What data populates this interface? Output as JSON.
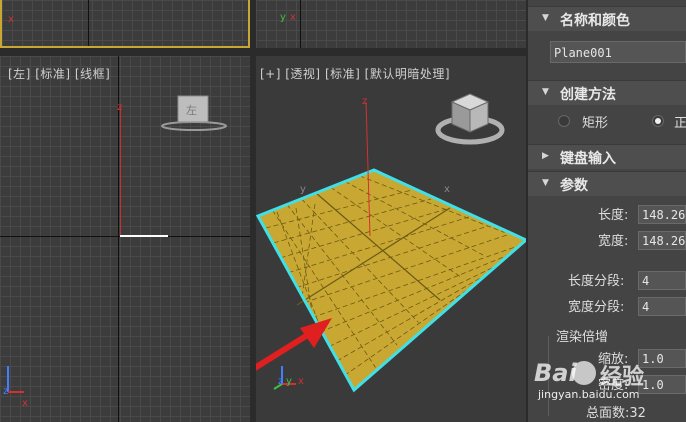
{
  "viewports": {
    "left": {
      "labels": [
        "[左]",
        "[标准]",
        "[线框]"
      ]
    },
    "perspective": {
      "labels": [
        "[+]",
        "[透视]",
        "[标准]",
        "[默认明暗处理]"
      ]
    }
  },
  "axes": {
    "x": "x",
    "y": "y",
    "z": "z"
  },
  "panel": {
    "name_color": {
      "title": "名称和颜色",
      "object_name": "Plane001"
    },
    "creation_method": {
      "title": "创建方法",
      "option_rect": "矩形",
      "option_square": "正"
    },
    "keyboard_entry": {
      "title": "键盘输入"
    },
    "parameters": {
      "title": "参数",
      "length_label": "长度:",
      "length_value": "148.26",
      "width_label": "宽度:",
      "width_value": "148.26",
      "length_segs_label": "长度分段:",
      "length_segs_value": "4",
      "width_segs_label": "宽度分段:",
      "width_segs_value": "4",
      "render_mult_title": "渲染倍增",
      "scale_label": "缩放:",
      "scale_value": "1.0",
      "density_label": "密度:",
      "density_value": "1.0",
      "total_faces": "总面数:32"
    }
  },
  "watermark": {
    "brand": "Bai",
    "brand2": "经验",
    "url": "jingyan.baidu.com"
  },
  "colors": {
    "plane": "#c8a832",
    "selection": "#40e0e8",
    "arrow": "#e02020",
    "viewport_bg": "#3c3c3c"
  }
}
